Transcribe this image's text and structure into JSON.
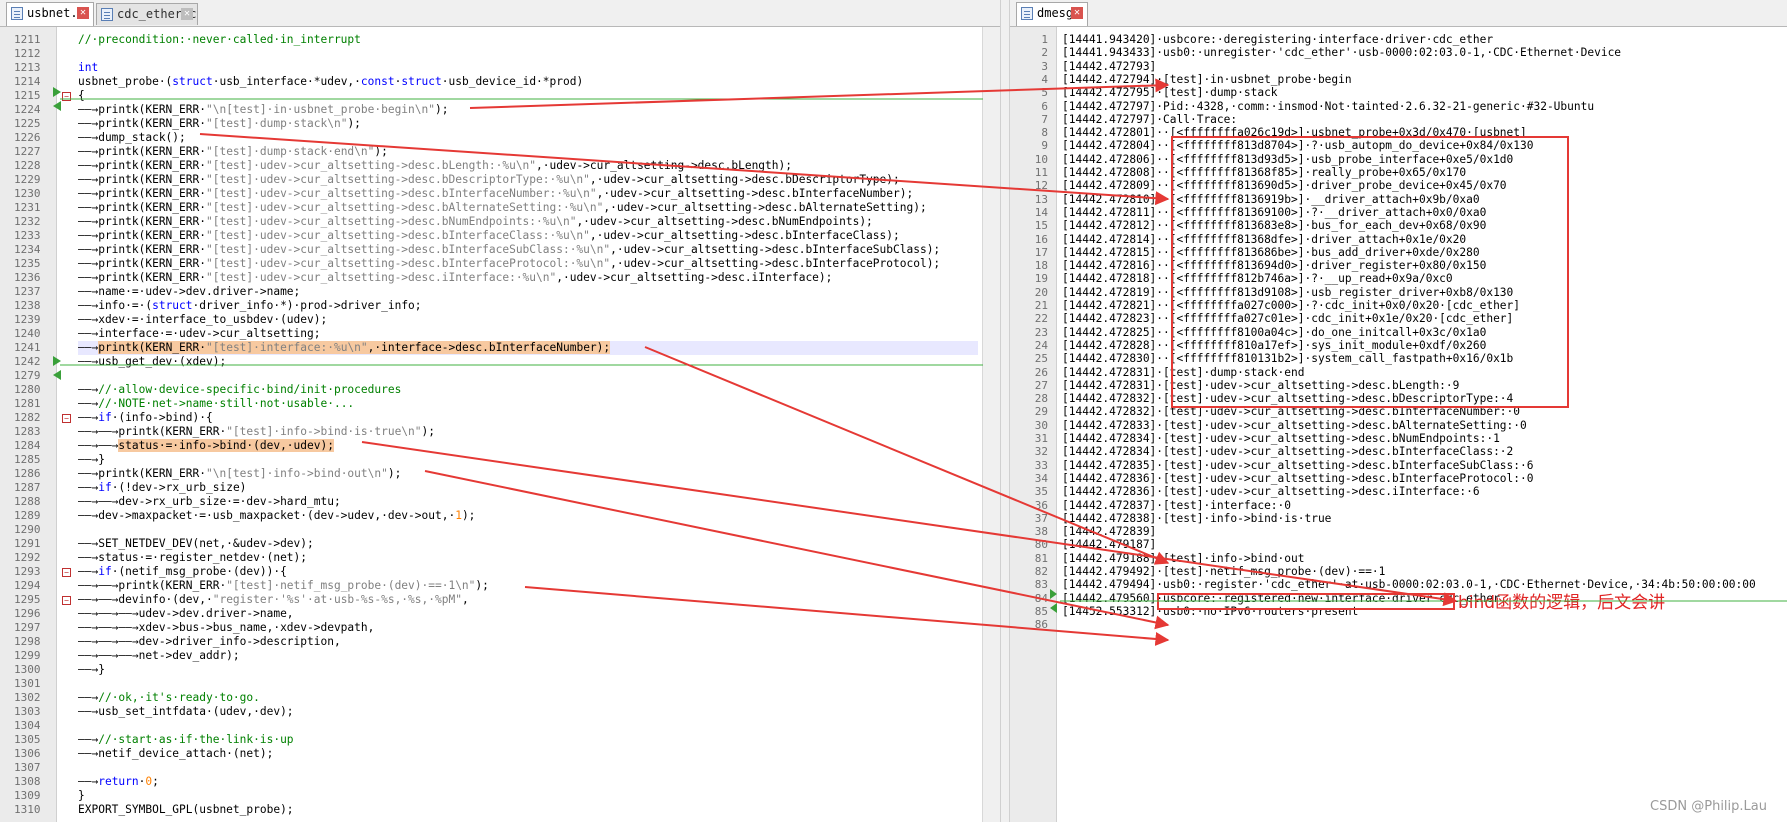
{
  "left_tabs": [
    {
      "label": "usbnet.c",
      "active": true
    },
    {
      "label": "cdc_ether.c",
      "active": false
    }
  ],
  "right_tabs": [
    {
      "label": "dmesg",
      "active": true
    }
  ],
  "close_glyph": "✕",
  "code_lines": [
    {
      "n": "1211",
      "html": "<span class=\"cm\">//·precondition:·never·called·in_interrupt</span>"
    },
    {
      "n": "1212",
      "html": ""
    },
    {
      "n": "1213",
      "html": "<span class=\"kw\">int</span>"
    },
    {
      "n": "1214",
      "html": "usbnet_probe·(<span class=\"kw\">struct</span>·usb_interface·*udev,·<span class=\"kw\">const</span>·<span class=\"kw\">struct</span>·usb_device_id·*prod)"
    },
    {
      "n": "1215",
      "html": "{"
    },
    {
      "n": "1224",
      "html": "——→printk(KERN_ERR·<span class=\"st\">\"\\n[test]·in·usbnet_probe·begin\\n\"</span>);"
    },
    {
      "n": "1225",
      "html": "——→printk(KERN_ERR·<span class=\"st\">\"[test]·dump·stack\\n\"</span>);"
    },
    {
      "n": "1226",
      "html": "——→dump_stack();"
    },
    {
      "n": "1227",
      "html": "——→printk(KERN_ERR·<span class=\"st\">\"[test]·dump·stack·end\\n\"</span>);"
    },
    {
      "n": "1228",
      "html": "——→printk(KERN_ERR·<span class=\"st\">\"[test]·udev->cur_altsetting->desc.bLength:·%u\\n\"</span>,·udev->cur_altsetting->desc.bLength);"
    },
    {
      "n": "1229",
      "html": "——→printk(KERN_ERR·<span class=\"st\">\"[test]·udev->cur_altsetting->desc.bDescriptorType:·%u\\n\"</span>,·udev->cur_altsetting->desc.bDescriptorType);"
    },
    {
      "n": "1230",
      "html": "——→printk(KERN_ERR·<span class=\"st\">\"[test]·udev->cur_altsetting->desc.bInterfaceNumber:·%u\\n\"</span>,·udev->cur_altsetting->desc.bInterfaceNumber);"
    },
    {
      "n": "1231",
      "html": "——→printk(KERN_ERR·<span class=\"st\">\"[test]·udev->cur_altsetting->desc.bAlternateSetting:·%u\\n\"</span>,·udev->cur_altsetting->desc.bAlternateSetting);"
    },
    {
      "n": "1232",
      "html": "——→printk(KERN_ERR·<span class=\"st\">\"[test]·udev->cur_altsetting->desc.bNumEndpoints:·%u\\n\"</span>,·udev->cur_altsetting->desc.bNumEndpoints);"
    },
    {
      "n": "1233",
      "html": "——→printk(KERN_ERR·<span class=\"st\">\"[test]·udev->cur_altsetting->desc.bInterfaceClass:·%u\\n\"</span>,·udev->cur_altsetting->desc.bInterfaceClass);"
    },
    {
      "n": "1234",
      "html": "——→printk(KERN_ERR·<span class=\"st\">\"[test]·udev->cur_altsetting->desc.bInterfaceSubClass:·%u\\n\"</span>,·udev->cur_altsetting->desc.bInterfaceSubClass);"
    },
    {
      "n": "1235",
      "html": "——→printk(KERN_ERR·<span class=\"st\">\"[test]·udev->cur_altsetting->desc.bInterfaceProtocol:·%u\\n\"</span>,·udev->cur_altsetting->desc.bInterfaceProtocol);"
    },
    {
      "n": "1236",
      "html": "——→printk(KERN_ERR·<span class=\"st\">\"[test]·udev->cur_altsetting->desc.iInterface:·%u\\n\"</span>,·udev->cur_altsetting->desc.iInterface);"
    },
    {
      "n": "1237",
      "html": "——→name·=·udev->dev.driver->name;"
    },
    {
      "n": "1238",
      "html": "——→info·=·(<span class=\"kw\">struct</span>·driver_info·*)·prod->driver_info;"
    },
    {
      "n": "1239",
      "html": "——→xdev·=·interface_to_usbdev·(udev);"
    },
    {
      "n": "1240",
      "html": "——→interface·=·udev->cur_altsetting;"
    },
    {
      "n": "1241",
      "html": "——→<span class=\"orange\">printk(KERN_ERR·<span class=\"st\">\"[test]·interface:·%u\\n\"</span>,·interface->desc.bInterfaceNumber);</span>"
    },
    {
      "n": "1242",
      "html": "——→usb_get_dev·(xdev);"
    },
    {
      "n": "1279",
      "html": ""
    },
    {
      "n": "1280",
      "html": "——→<span class=\"cm\">//·allow·device-specific·bind/init·procedures</span>"
    },
    {
      "n": "1281",
      "html": "——→<span class=\"cm\">//·NOTE·net->name·still·not·usable·...</span>"
    },
    {
      "n": "1282",
      "html": "——→<span class=\"kw\">if</span>·(info->bind)·{"
    },
    {
      "n": "1283",
      "html": "——→——→printk(KERN_ERR·<span class=\"st\">\"[test]·info->bind·is·true\\n\"</span>);"
    },
    {
      "n": "1284",
      "html": "——→——→<span class=\"orange\">status·=·info->bind·(dev,·udev);</span>"
    },
    {
      "n": "1285",
      "html": "——→}"
    },
    {
      "n": "1286",
      "html": "——→printk(KERN_ERR·<span class=\"st\">\"\\n[test]·info->bind·out\\n\"</span>);"
    },
    {
      "n": "1287",
      "html": "——→<span class=\"kw\">if</span>·(!dev->rx_urb_size)"
    },
    {
      "n": "1288",
      "html": "——→——→dev->rx_urb_size·=·dev->hard_mtu;"
    },
    {
      "n": "1289",
      "html": "——→dev->maxpacket·=·usb_maxpacket·(dev->udev,·dev->out,·<span class=\"nm\">1</span>);"
    },
    {
      "n": "1290",
      "html": ""
    },
    {
      "n": "1291",
      "html": "——→SET_NETDEV_DEV(net,·&udev->dev);"
    },
    {
      "n": "1292",
      "html": "——→status·=·register_netdev·(net);"
    },
    {
      "n": "1293",
      "html": "——→<span class=\"kw\">if</span>·(netif_msg_probe·(dev))·{"
    },
    {
      "n": "1294",
      "html": "——→——→printk(KERN_ERR·<span class=\"st\">\"[test]·netif_msg_probe·(dev)·==·1\\n\"</span>);"
    },
    {
      "n": "1295",
      "html": "——→——→devinfo·(dev,·<span class=\"st\">\"register·'%s'·at·usb-%s-%s,·%s,·%pM\"</span>,"
    },
    {
      "n": "1296",
      "html": "——→——→——→udev->dev.driver->name,"
    },
    {
      "n": "1297",
      "html": "——→——→——→xdev->bus->bus_name,·xdev->devpath,"
    },
    {
      "n": "1298",
      "html": "——→——→——→dev->driver_info->description,"
    },
    {
      "n": "1299",
      "html": "——→——→——→net->dev_addr);"
    },
    {
      "n": "1300",
      "html": "——→}"
    },
    {
      "n": "1301",
      "html": ""
    },
    {
      "n": "1302",
      "html": "——→<span class=\"cm\">//·ok,·it's·ready·to·go.</span>"
    },
    {
      "n": "1303",
      "html": "——→usb_set_intfdata·(udev,·dev);"
    },
    {
      "n": "1304",
      "html": ""
    },
    {
      "n": "1305",
      "html": "——→<span class=\"cm\">//·start·as·if·the·link·is·up</span>"
    },
    {
      "n": "1306",
      "html": "——→netif_device_attach·(net);"
    },
    {
      "n": "1307",
      "html": ""
    },
    {
      "n": "1308",
      "html": "——→<span class=\"kw\">return</span>·<span class=\"nm\">0</span>;"
    },
    {
      "n": "1309",
      "html": "}"
    },
    {
      "n": "1310",
      "html": "EXPORT_SYMBOL_GPL(usbnet_probe);"
    }
  ],
  "log_lines": [
    {
      "n": "1",
      "t": "[14441.943420]·usbcore:·deregistering·interface·driver·cdc_ether"
    },
    {
      "n": "2",
      "t": "[14441.943433]·usb0:·unregister·'cdc_ether'·usb-0000:02:03.0-1,·CDC·Ethernet·Device"
    },
    {
      "n": "3",
      "t": "[14442.472793]"
    },
    {
      "n": "4",
      "t": "[14442.472794]·[test]·in·usbnet_probe·begin"
    },
    {
      "n": "5",
      "t": "[14442.472795]·[test]·dump·stack"
    },
    {
      "n": "6",
      "t": "[14442.472797]·Pid:·4328,·comm:·insmod·Not·tainted·2.6.32-21-generic·#32-Ubuntu"
    },
    {
      "n": "7",
      "t": "[14442.472797]·Call·Trace:"
    },
    {
      "n": "8",
      "t": "[14442.472801]··[<ffffffffa026c19d>]·usbnet_probe+0x3d/0x470·[usbnet]"
    },
    {
      "n": "9",
      "t": "[14442.472804]··[<ffffffff813d8704>]·?·usb_autopm_do_device+0x84/0x130"
    },
    {
      "n": "10",
      "t": "[14442.472806]··[<ffffffff813d93d5>]·usb_probe_interface+0xe5/0x1d0"
    },
    {
      "n": "11",
      "t": "[14442.472808]··[<ffffffff81368f85>]·really_probe+0x65/0x170"
    },
    {
      "n": "12",
      "t": "[14442.472809]··[<ffffffff813690d5>]·driver_probe_device+0x45/0x70"
    },
    {
      "n": "13",
      "t": "[14442.472810]··[<ffffffff8136919b>]·__driver_attach+0x9b/0xa0"
    },
    {
      "n": "14",
      "t": "[14442.472811]··[<ffffffff81369100>]·?·__driver_attach+0x0/0xa0"
    },
    {
      "n": "15",
      "t": "[14442.472812]··[<ffffffff813683e8>]·bus_for_each_dev+0x68/0x90"
    },
    {
      "n": "16",
      "t": "[14442.472814]··[<ffffffff81368dfe>]·driver_attach+0x1e/0x20"
    },
    {
      "n": "17",
      "t": "[14442.472815]··[<ffffffff813686be>]·bus_add_driver+0xde/0x280"
    },
    {
      "n": "18",
      "t": "[14442.472816]··[<ffffffff813694d0>]·driver_register+0x80/0x150"
    },
    {
      "n": "19",
      "t": "[14442.472818]··[<ffffffff812b746a>]·?·__up_read+0x9a/0xc0"
    },
    {
      "n": "20",
      "t": "[14442.472819]··[<ffffffff813d9108>]·usb_register_driver+0xb8/0x130"
    },
    {
      "n": "21",
      "t": "[14442.472821]··[<ffffffffa027c000>]·?·cdc_init+0x0/0x20·[cdc_ether]"
    },
    {
      "n": "22",
      "t": "[14442.472823]··[<ffffffffa027c01e>]·cdc_init+0x1e/0x20·[cdc_ether]"
    },
    {
      "n": "23",
      "t": "[14442.472825]··[<ffffffff8100a04c>]·do_one_initcall+0x3c/0x1a0"
    },
    {
      "n": "24",
      "t": "[14442.472828]··[<ffffffff810a17ef>]·sys_init_module+0xdf/0x260"
    },
    {
      "n": "25",
      "t": "[14442.472830]··[<ffffffff810131b2>]·system_call_fastpath+0x16/0x1b"
    },
    {
      "n": "26",
      "t": "[14442.472831]·[test]·dump·stack·end"
    },
    {
      "n": "27",
      "t": "[14442.472831]·[test]·udev->cur_altsetting->desc.bLength:·9"
    },
    {
      "n": "28",
      "t": "[14442.472832]·[test]·udev->cur_altsetting->desc.bDescriptorType:·4"
    },
    {
      "n": "29",
      "t": "[14442.472832]·[test]·udev->cur_altsetting->desc.bInterfaceNumber:·0"
    },
    {
      "n": "30",
      "t": "[14442.472833]·[test]·udev->cur_altsetting->desc.bAlternateSetting:·0"
    },
    {
      "n": "31",
      "t": "[14442.472834]·[test]·udev->cur_altsetting->desc.bNumEndpoints:·1"
    },
    {
      "n": "32",
      "t": "[14442.472834]·[test]·udev->cur_altsetting->desc.bInterfaceClass:·2"
    },
    {
      "n": "33",
      "t": "[14442.472835]·[test]·udev->cur_altsetting->desc.bInterfaceSubClass:·6"
    },
    {
      "n": "34",
      "t": "[14442.472836]·[test]·udev->cur_altsetting->desc.bInterfaceProtocol:·0"
    },
    {
      "n": "35",
      "t": "[14442.472836]·[test]·udev->cur_altsetting->desc.iInterface:·6"
    },
    {
      "n": "36",
      "t": "[14442.472837]·[test]·interface:·0"
    },
    {
      "n": "37",
      "t": "[14442.472838]·[test]·info->bind·is·true"
    },
    {
      "n": "38",
      "t": "[14442.472839]"
    },
    {
      "n": "80",
      "t": "[14442.479187]"
    },
    {
      "n": "81",
      "t": "[14442.479188]·[test]·info->bind·out"
    },
    {
      "n": "82",
      "t": "[14442.479492]·[test]·netif_msg_probe·(dev)·==·1"
    },
    {
      "n": "83",
      "t": "[14442.479494]·usb0:·register·'cdc_ether'·at·usb-0000:02:03.0-1,·CDC·Ethernet·Device,·34:4b:50:00:00:00"
    },
    {
      "n": "84",
      "t": "[14442.479560]·usbcore:·registered·new·interface·driver·cdc_ether"
    },
    {
      "n": "85",
      "t": "[14452.553312]·usb0:·no·IPv6·routers·present"
    },
    {
      "n": "86",
      "t": ""
    }
  ],
  "annotation_text": "bind函数的逻辑，后文会讲",
  "watermark": "CSDN @Philip.Lau",
  "colors": {
    "arrow": "#e53935",
    "fold_marker": "#3aa03a",
    "keyword": "#0000ff",
    "comment": "#008000"
  }
}
